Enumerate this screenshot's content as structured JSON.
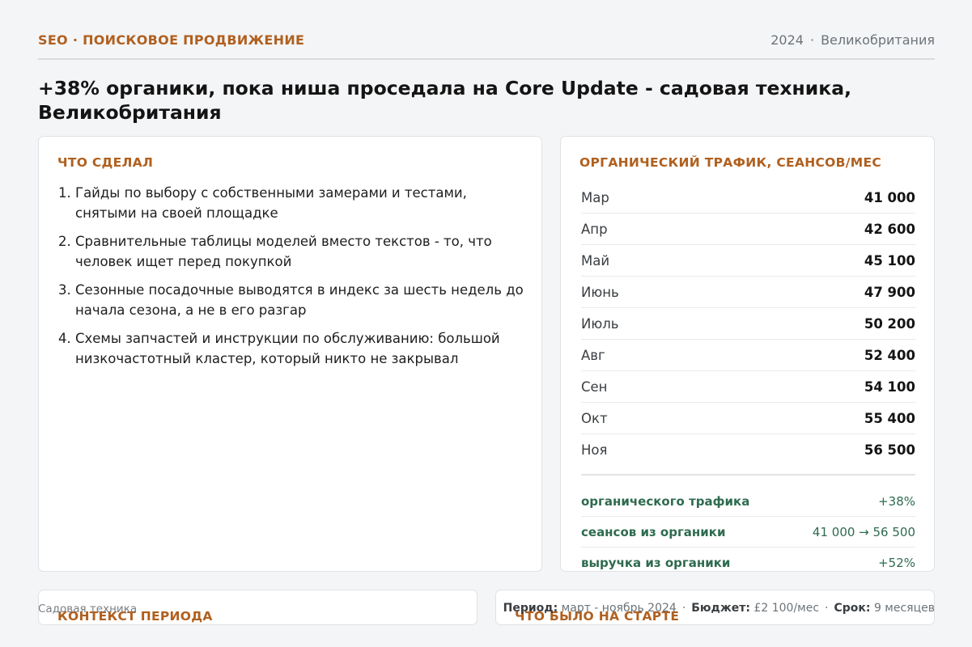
{
  "header": {
    "eyebrow": "SEO · ПОИСКОВОЕ ПРОДВИЖЕНИЕ",
    "year": "2024",
    "region": "Великобритания"
  },
  "title": "+38% органики, пока ниша проседала на Core Update - садовая техника, Великобритания",
  "actions": {
    "heading": "ЧТО СДЕЛАЛ",
    "items": [
      "Гайды по выбору с собственными замерами и тестами, снятыми на своей площадке",
      "Сравнительные таблицы моделей вместо текстов - то, что человек ищет перед покупкой",
      "Сезонные посадочные выводятся в индекс за шесть недель до начала сезона, а не в его разгар",
      "Схемы запчастей и инструкции по обслуживанию: большой низкочастотный кластер, который никто не закрывал"
    ]
  },
  "traffic": {
    "heading": "ОРГАНИЧЕСКИЙ ТРАФИК, СЕАНСОВ/МЕС",
    "rows": [
      {
        "month": "Мар",
        "value": "41 000"
      },
      {
        "month": "Апр",
        "value": "42 600"
      },
      {
        "month": "Май",
        "value": "45 100"
      },
      {
        "month": "Июнь",
        "value": "47 900"
      },
      {
        "month": "Июль",
        "value": "50 200"
      },
      {
        "month": "Авг",
        "value": "52 400"
      },
      {
        "month": "Сен",
        "value": "54 100"
      },
      {
        "month": "Окт",
        "value": "55 400"
      },
      {
        "month": "Ноя",
        "value": "56 500"
      }
    ],
    "results": [
      {
        "label": "органического трафика",
        "value": "+38%"
      },
      {
        "label": "сеансов из органики",
        "value": "41 000 → 56 500"
      },
      {
        "label": "выручка из органики",
        "value": "+52%"
      }
    ]
  },
  "context": {
    "heading": "КОНТЕКСТ ПЕРИОДА"
  },
  "start": {
    "heading": "ЧТО БЫЛО НА СТАРТЕ"
  },
  "footer": {
    "niche": "Садовая техника",
    "period_label": "Период:",
    "period_value": "март - ноябрь 2024",
    "budget_label": "Бюджет:",
    "budget_value": "£2 100/мес",
    "term_label": "Срок:",
    "term_value": "9 месяцев"
  },
  "colors": {
    "accent": "#b0601f",
    "positive": "#2e6b4f",
    "background": "#f4f5f7"
  }
}
